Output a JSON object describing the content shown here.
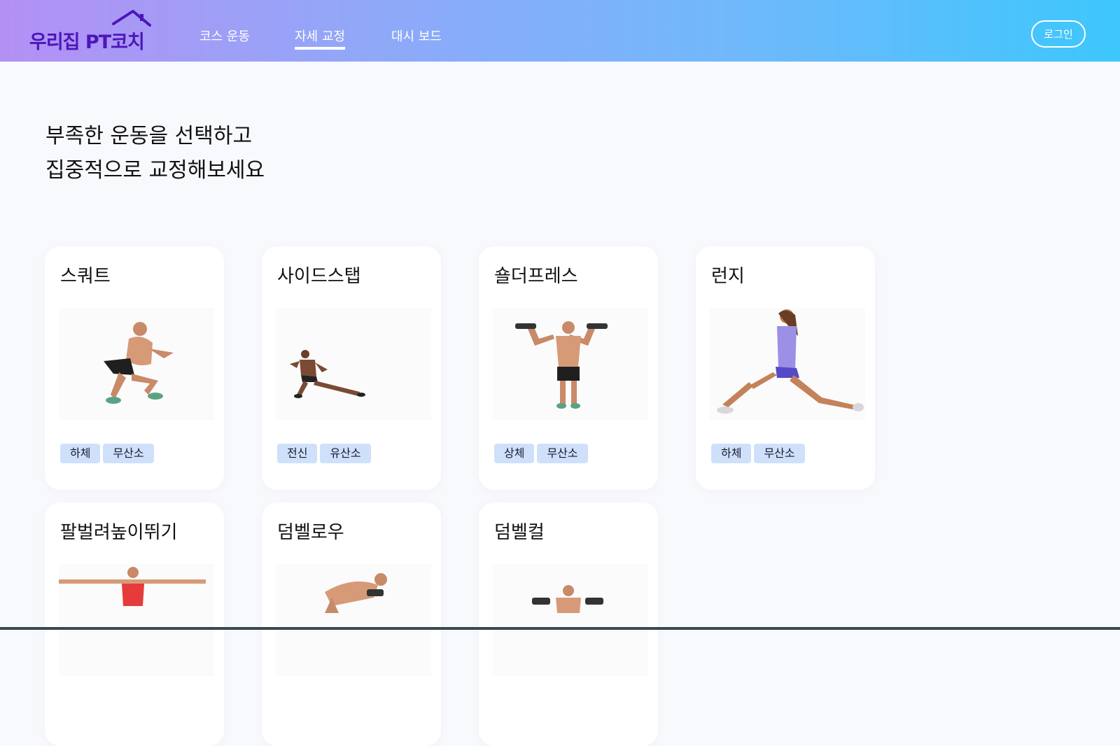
{
  "header": {
    "logo_text": "우리집 PT코치",
    "nav": [
      {
        "label": "코스 운동"
      },
      {
        "label": "자세 교정"
      },
      {
        "label": "대시 보드"
      }
    ],
    "login_label": "로그인"
  },
  "hero": {
    "line1": "부족한 운동을 선택하고",
    "line2": "집중적으로 교정해보세요"
  },
  "cards": [
    {
      "title": "스쿼트",
      "tags": [
        "하체",
        "무산소"
      ]
    },
    {
      "title": "사이드스탭",
      "tags": [
        "전신",
        "유산소"
      ]
    },
    {
      "title": "숄더프레스",
      "tags": [
        "상체",
        "무산소"
      ]
    },
    {
      "title": "런지",
      "tags": [
        "하체",
        "무산소"
      ]
    },
    {
      "title": "팔벌려높이뛰기",
      "tags": []
    },
    {
      "title": "덤벨로우",
      "tags": []
    },
    {
      "title": "덤벨컬",
      "tags": []
    }
  ],
  "colors": {
    "logo": "#4c16b9",
    "tag_bg": "#cfe0fb",
    "header_start": "#b490f5",
    "header_end": "#3dc7fc"
  }
}
